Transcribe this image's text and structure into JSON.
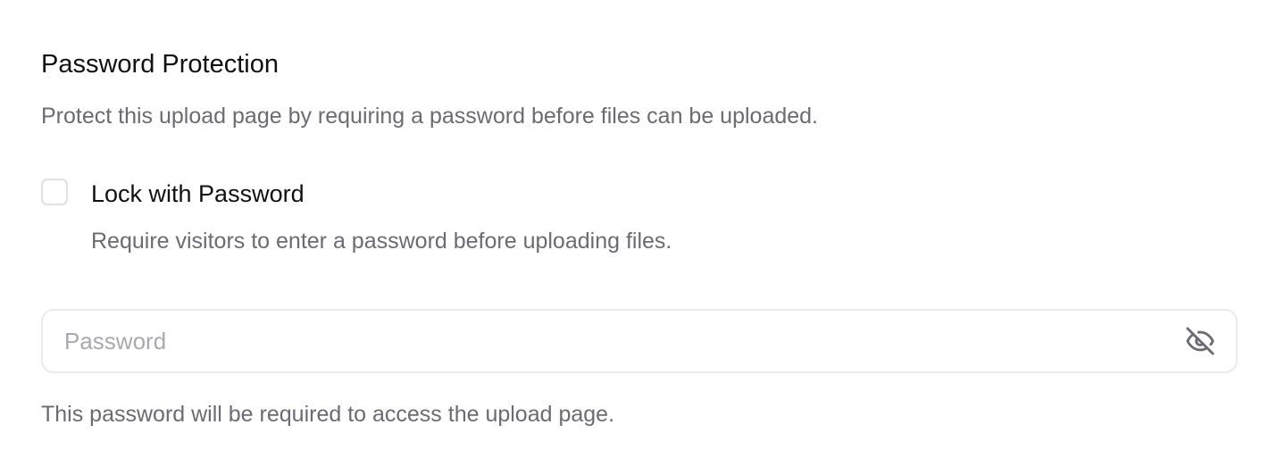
{
  "section": {
    "title": "Password Protection",
    "description": "Protect this upload page by requiring a password before files can be uploaded."
  },
  "lock": {
    "label": "Lock with Password",
    "help": "Require visitors to enter a password before uploading files.",
    "checked": false
  },
  "password": {
    "value": "",
    "placeholder": "Password",
    "toggle_icon": "eye-off-icon",
    "help": "This password will be required to access the upload page."
  },
  "colors": {
    "title_text": "#111111",
    "muted_text": "#6b6b73",
    "placeholder_text": "#a9a9b0",
    "border": "#ebebee",
    "icon": "#6b6b73"
  }
}
